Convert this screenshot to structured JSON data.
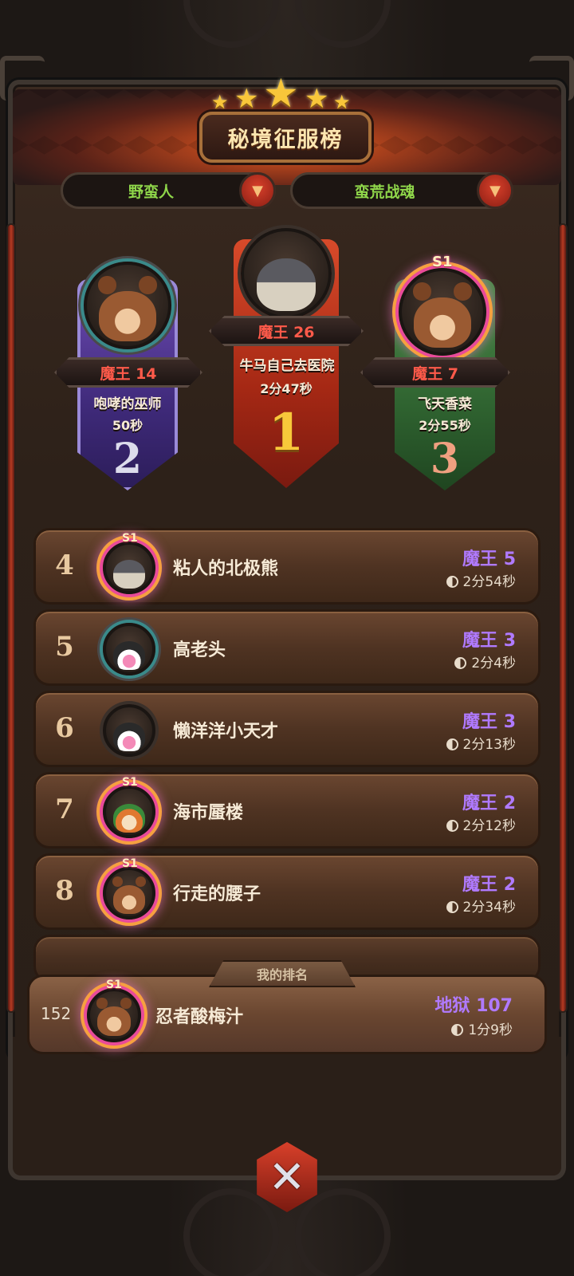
{
  "title": "秘境征服榜",
  "filters": {
    "class": "野蛮人",
    "spec": "蛮荒战魂"
  },
  "podium": {
    "first": {
      "place": "1",
      "level": "魔王 26",
      "name": "牛马自己去医院",
      "time": "2分47秒"
    },
    "second": {
      "place": "2",
      "level": "魔王 14",
      "name": "咆哮的巫师",
      "time": "50秒"
    },
    "third": {
      "place": "3",
      "level": "魔王 7",
      "name": "飞天香菜",
      "time": "2分55秒",
      "badge": "S1"
    }
  },
  "list": [
    {
      "rank": "4",
      "name": "粘人的北极熊",
      "level": "魔王 5",
      "time": "2分54秒",
      "badge": "S1"
    },
    {
      "rank": "5",
      "name": "高老头",
      "level": "魔王 3",
      "time": "2分4秒"
    },
    {
      "rank": "6",
      "name": "懒洋洋小天才",
      "level": "魔王 3",
      "time": "2分13秒"
    },
    {
      "rank": "7",
      "name": "海市蜃楼",
      "level": "魔王 2",
      "time": "2分12秒",
      "badge": "S1"
    },
    {
      "rank": "8",
      "name": "行走的腰子",
      "level": "魔王 2",
      "time": "2分34秒",
      "badge": "S1"
    }
  ],
  "my_rank": {
    "label": "我的排名",
    "rank": "152",
    "name": "忍者酸梅汁",
    "level": "地狱 107",
    "time": "1分9秒",
    "badge": "S1"
  },
  "icons": [
    "caret-down-icon",
    "clock-icon",
    "close-icon",
    "star-icon"
  ],
  "colors": {
    "level_purple": "#b07aff",
    "rank_red": "#ff5a4a",
    "filter_green": "#8fd64a"
  }
}
